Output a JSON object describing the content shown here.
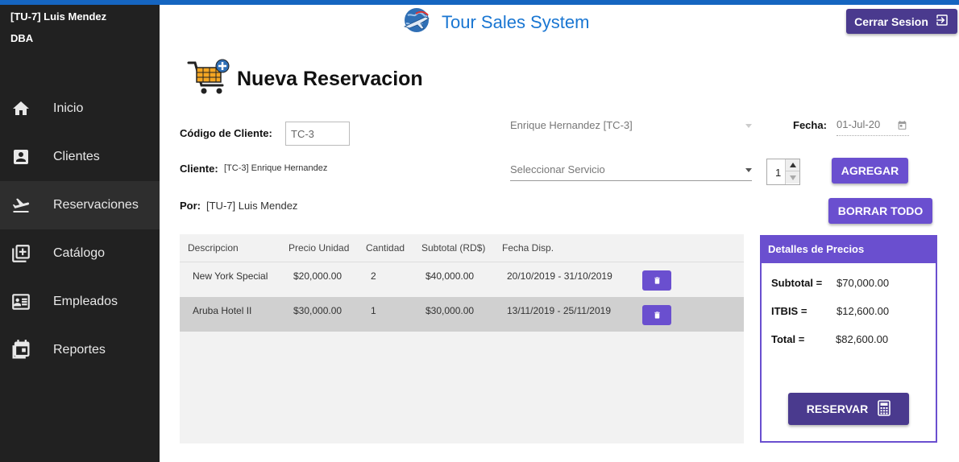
{
  "sidebar": {
    "user_name": "[TU-7] Luis Mendez",
    "user_role": "DBA",
    "items": [
      {
        "label": "Inicio",
        "icon": "home-icon"
      },
      {
        "label": "Clientes",
        "icon": "contact-icon"
      },
      {
        "label": "Reservaciones",
        "icon": "flight-icon"
      },
      {
        "label": "Catálogo",
        "icon": "library-add-icon"
      },
      {
        "label": "Empleados",
        "icon": "badge-icon"
      },
      {
        "label": "Reportes",
        "icon": "calendar-icon"
      }
    ],
    "active_index": 2
  },
  "header": {
    "brand": "Tour Sales System",
    "logout_label": "Cerrar Sesion"
  },
  "page": {
    "title": "Nueva Reservacion"
  },
  "form": {
    "code_label": "Código de Cliente:",
    "code_value": "TC-3",
    "client_label": "Cliente:",
    "client_value": "[TC-3] Enrique Hernandez",
    "by_label": "Por:",
    "by_value": "[TU-7] Luis Mendez",
    "client_select": "Enrique Hernandez [TC-3]",
    "date_label": "Fecha:",
    "date_value": "01-Jul-20",
    "service_select": "Seleccionar Servicio",
    "quantity": "1",
    "add_label": "AGREGAR",
    "clear_label": "BORRAR TODO"
  },
  "table": {
    "headers": [
      "Descripcion",
      "Precio Unidad",
      "Cantidad",
      "Subtotal (RD$)",
      "Fecha Disp."
    ],
    "rows": [
      {
        "descripcion": "New York Special",
        "precio": "$20,000.00",
        "cantidad": "2",
        "subtotal": "$40,000.00",
        "fecha": "20/10/2019 - 31/10/2019"
      },
      {
        "descripcion": "Aruba Hotel II",
        "precio": "$30,000.00",
        "cantidad": "1",
        "subtotal": "$30,000.00",
        "fecha": "13/11/2019 - 25/11/2019"
      }
    ]
  },
  "prices": {
    "title": "Detalles de Precios",
    "subtotal_label": "Subtotal =",
    "subtotal_value": "$70,000.00",
    "itbis_label": "ITBIS =",
    "itbis_value": "$12,600.00",
    "total_label": "Total =",
    "total_value": "$82,600.00",
    "reserve_label": "RESERVAR"
  },
  "colors": {
    "accent": "#6a4fcf",
    "accent_dark": "#4a3a8e",
    "brand_blue": "#1976d2",
    "sidebar_bg": "#212121"
  }
}
